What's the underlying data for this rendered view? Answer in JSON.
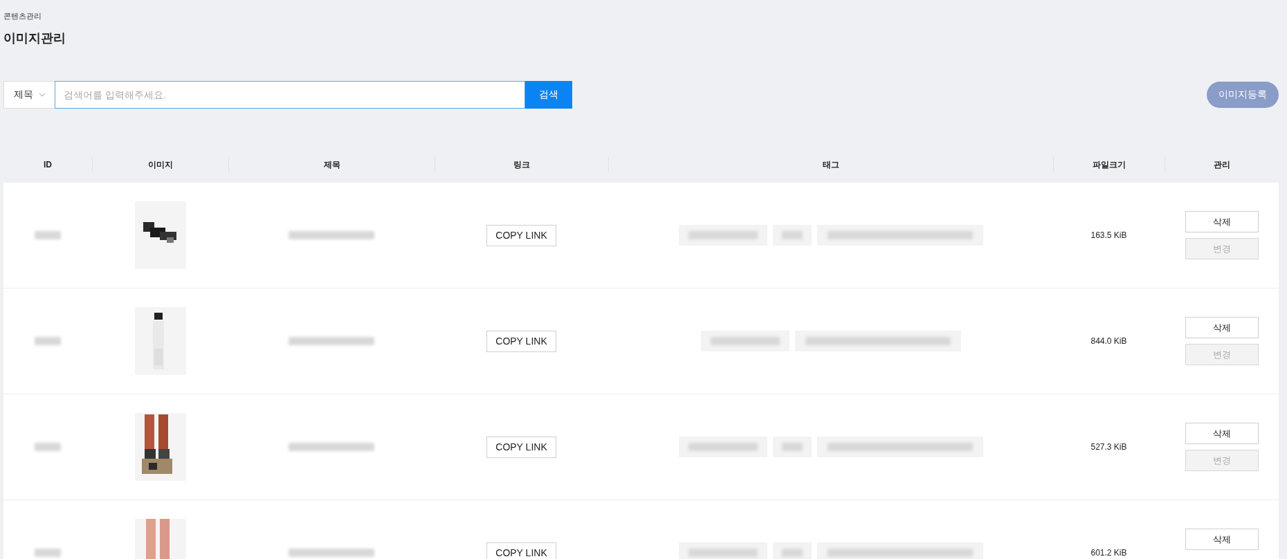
{
  "breadcrumb": "콘텐츠관리",
  "title": "이미지관리",
  "search": {
    "filter": "제목",
    "placeholder": "검색어를 입력해주세요.",
    "button": "검색"
  },
  "register_button": "이미지등록",
  "table": {
    "columns": [
      "ID",
      "이미지",
      "제목",
      "링크",
      "태그",
      "파일크기",
      "관리"
    ],
    "rows": [
      {
        "id_redacted": true,
        "image": {
          "kind": "picture"
        },
        "title_redacted": true,
        "link_button": "COPY LINK",
        "tags": [
          {
            "redacted": true
          },
          {
            "redacted": true
          },
          {
            "redacted": true
          }
        ],
        "size": "163.5 KiB",
        "delete_button": "삭제",
        "edit_button": {
          "label": "변경",
          "disabled": true
        }
      },
      {
        "id_redacted": true,
        "image": {
          "kind": "picture"
        },
        "title_redacted": true,
        "link_button": "COPY LINK",
        "tags": [
          {
            "redacted": true
          },
          {
            "redacted": true
          }
        ],
        "size": "844.0 KiB",
        "delete_button": "삭제",
        "edit_button": {
          "label": "변경",
          "disabled": true
        }
      },
      {
        "id_redacted": true,
        "image": {
          "kind": "picture"
        },
        "title_redacted": true,
        "link_button": "COPY LINK",
        "tags": [
          {
            "redacted": true
          },
          {
            "redacted": true
          },
          {
            "redacted": true
          }
        ],
        "size": "527.3 KiB",
        "delete_button": "삭제",
        "edit_button": {
          "label": "변경",
          "disabled": true
        }
      },
      {
        "id_redacted": true,
        "image": {
          "kind": "picture"
        },
        "title_redacted": true,
        "link_button": "COPY LINK",
        "tags": [
          {
            "redacted": true
          },
          {
            "redacted": true
          },
          {
            "redacted": true
          }
        ],
        "size": "601.2 KiB",
        "delete_button": "삭제"
      }
    ]
  }
}
